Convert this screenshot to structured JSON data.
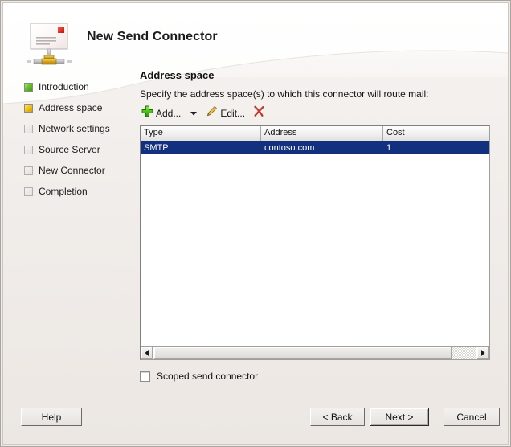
{
  "window": {
    "title": "New Send Connector",
    "icon": "send-connector-envelope-icon"
  },
  "sidebar": {
    "items": [
      {
        "label": "Introduction",
        "state": "done",
        "icon": "status-square-green-icon"
      },
      {
        "label": "Address space",
        "state": "current",
        "icon": "status-square-amber-icon"
      },
      {
        "label": "Network settings",
        "state": "todo",
        "icon": "status-square-empty-icon"
      },
      {
        "label": "Source Server",
        "state": "todo",
        "icon": "status-square-empty-icon"
      },
      {
        "label": "New Connector",
        "state": "todo",
        "icon": "status-square-empty-icon"
      },
      {
        "label": "Completion",
        "state": "todo",
        "icon": "status-square-empty-icon"
      }
    ]
  },
  "main": {
    "heading": "Address space",
    "description": "Specify the address space(s) to which this connector will route mail:",
    "toolbar": {
      "add_label": "Add...",
      "add_icon": "green-plus-icon",
      "dropdown_icon": "chevron-down-icon",
      "edit_label": "Edit...",
      "edit_icon": "pencil-icon",
      "delete_icon": "red-x-icon"
    },
    "table": {
      "columns": [
        "Type",
        "Address",
        "Cost"
      ],
      "rows": [
        {
          "type": "SMTP",
          "address": "contoso.com",
          "cost": "1",
          "selected": true
        }
      ]
    },
    "scrollbar": {
      "left_arrow_icon": "arrow-left-icon",
      "right_arrow_icon": "arrow-right-icon"
    },
    "checkbox": {
      "label": "Scoped send connector",
      "checked": false
    }
  },
  "footer": {
    "help_label": "Help",
    "back_label": "< Back",
    "next_label": "Next >",
    "cancel_label": "Cancel"
  },
  "colors": {
    "selection_blue": "#13307e",
    "status_done_green": "#63c524",
    "status_current_amber": "#f2c518",
    "dialog_background": "#efebe7",
    "add_icon_green": "#4caf22",
    "delete_icon_red": "#c0392b"
  }
}
